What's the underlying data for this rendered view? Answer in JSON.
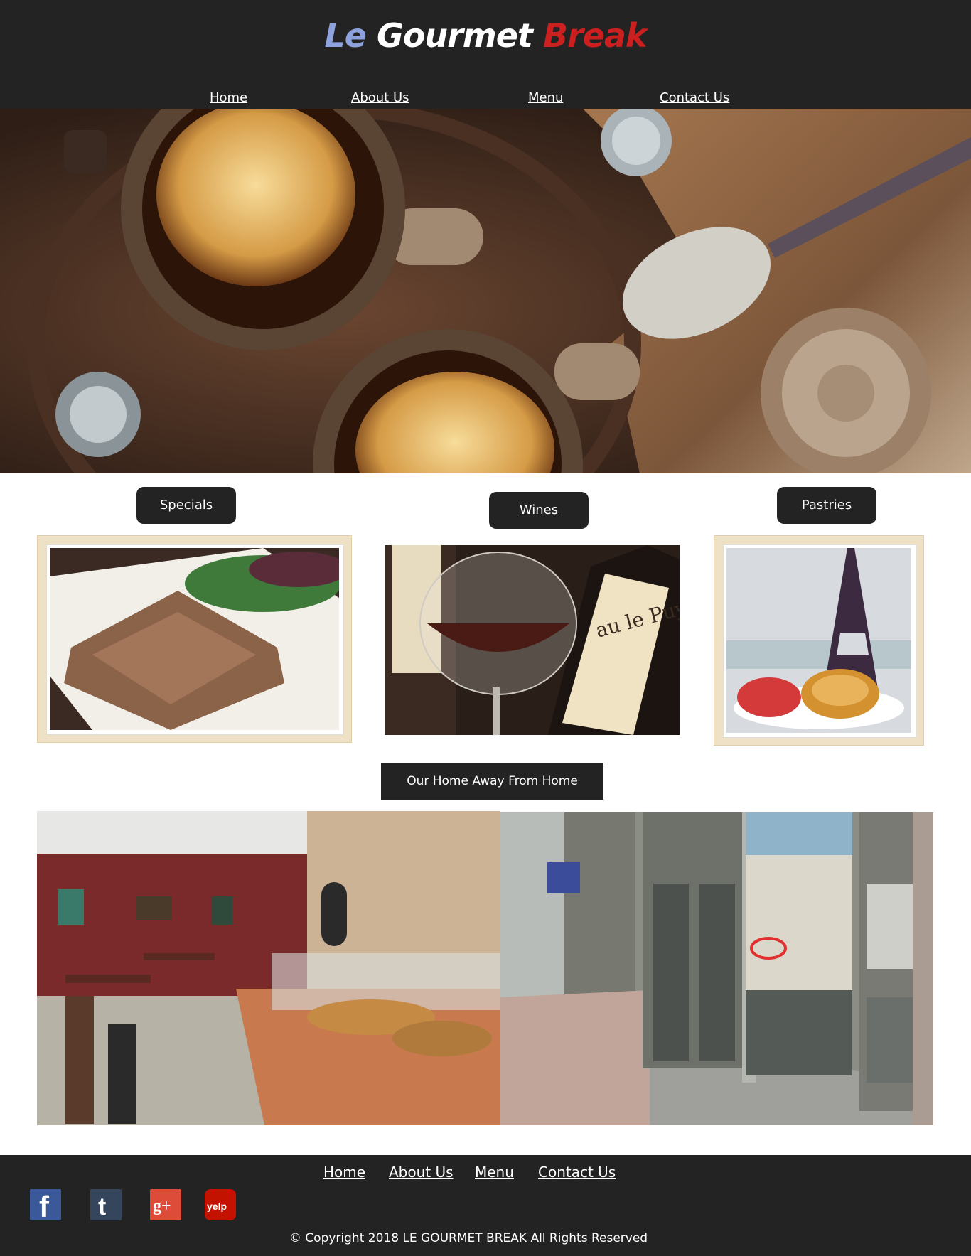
{
  "brand": {
    "part1": "Le",
    "part2": "Gourmet",
    "part3": "Break",
    "colors": {
      "part1": "#8ea2de",
      "part2": "#ffffff",
      "part3": "#cc1f1f"
    }
  },
  "nav": [
    {
      "label": "Home"
    },
    {
      "label": "About Us"
    },
    {
      "label": "Menu"
    },
    {
      "label": "Contact Us"
    }
  ],
  "hero": {
    "image": "french-onion-soup-photo"
  },
  "categories": [
    {
      "label": "Specials",
      "image": "crepe-photo"
    },
    {
      "label": "Wines",
      "image": "wine-bottles-photo"
    },
    {
      "label": "Pastries",
      "image": "pastries-eiffel-tower-photo"
    }
  ],
  "home_section": {
    "label": "Our Home Away From Home",
    "interior_image": "cafe-interior-photo",
    "exterior_image": "cafe-storefront-photo"
  },
  "footer": {
    "nav": [
      {
        "label": "Home"
      },
      {
        "label": "About Us"
      },
      {
        "label": "Menu"
      },
      {
        "label": "Contact Us"
      }
    ],
    "social": [
      {
        "name": "facebook-icon",
        "glyph": "f",
        "color": "#3b5998"
      },
      {
        "name": "tumblr-icon",
        "glyph": "t",
        "color": "#35465c"
      },
      {
        "name": "google-plus-icon",
        "glyph": "g+",
        "color": "#dd4b39"
      },
      {
        "name": "yelp-icon",
        "glyph": "yelp",
        "color": "#c41200"
      }
    ],
    "copyright": "© Copyright 2018 LE GOURMET BREAK All Rights Reserved"
  },
  "theme": {
    "dark": "#232323",
    "background": "#ffffff"
  }
}
